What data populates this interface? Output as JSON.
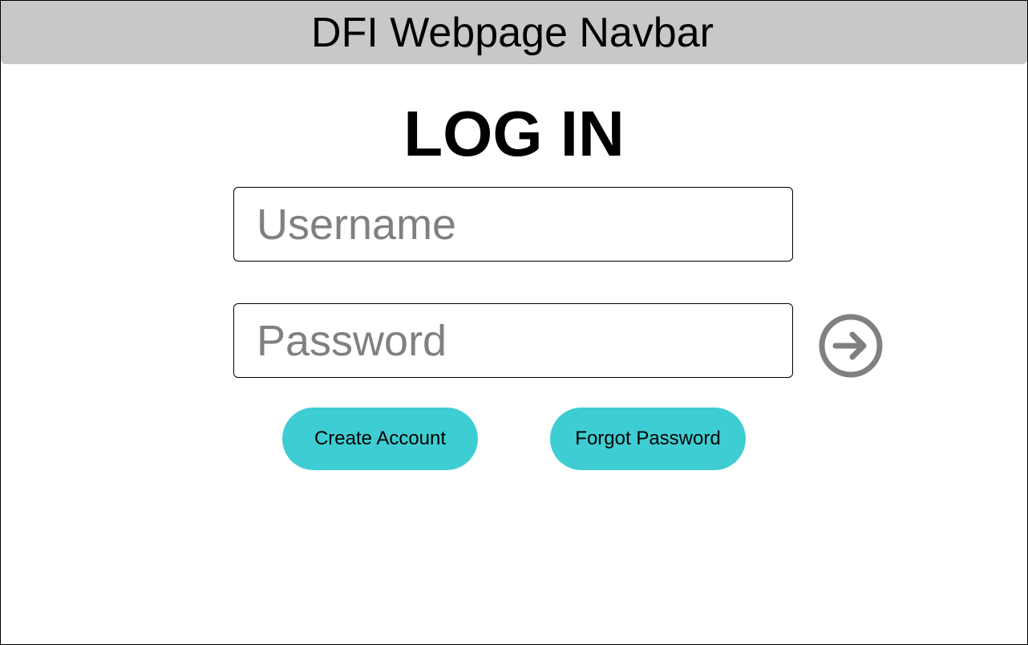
{
  "navbar": {
    "title": "DFI Webpage Navbar",
    "background_color": "#c8c8c8"
  },
  "login": {
    "heading": "LOG IN",
    "username": {
      "placeholder": "Username",
      "value": ""
    },
    "password": {
      "placeholder": "Password",
      "value": ""
    },
    "submit_icon": "arrow-right-circle-icon",
    "create_account_label": "Create Account",
    "forgot_password_label": "Forgot Password"
  },
  "colors": {
    "accent": "#3ecdd2",
    "icon": "#808080",
    "placeholder": "#808080"
  }
}
